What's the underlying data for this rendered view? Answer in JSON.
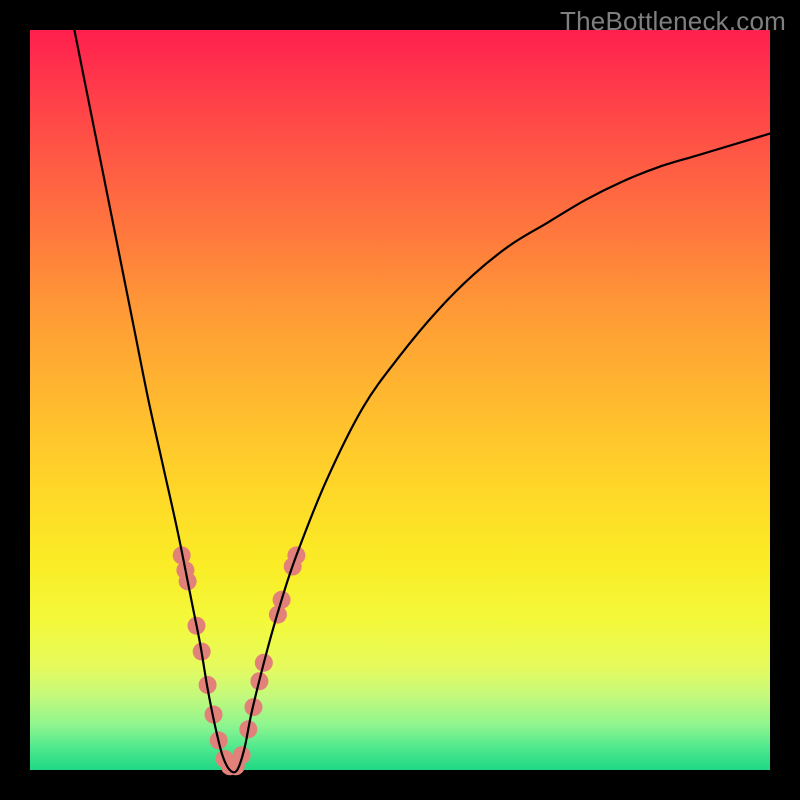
{
  "watermark": "TheBottleneck.com",
  "chart_data": {
    "type": "line",
    "title": "",
    "xlabel": "",
    "ylabel": "",
    "xlim": [
      0,
      100
    ],
    "ylim": [
      0,
      100
    ],
    "grid": false,
    "legend": false,
    "background_gradient": {
      "top": "#ff1f4d",
      "bottom": "#1fd885",
      "stops": [
        {
          "pos": 0.0,
          "color": "#ff1f4d"
        },
        {
          "pos": 0.5,
          "color": "#ffb92f"
        },
        {
          "pos": 0.8,
          "color": "#f3f93b"
        },
        {
          "pos": 1.0,
          "color": "#1fd885"
        }
      ]
    },
    "series": [
      {
        "name": "bottleneck-curve",
        "color": "#000000",
        "x": [
          6,
          8,
          10,
          12,
          14,
          16,
          18,
          20,
          22,
          23,
          24,
          25,
          26,
          27,
          28,
          29,
          30,
          32,
          34,
          36,
          40,
          45,
          50,
          55,
          60,
          65,
          70,
          75,
          80,
          85,
          90,
          95,
          100
        ],
        "y": [
          100,
          90,
          80,
          70,
          60,
          50,
          41,
          32,
          22,
          17,
          11,
          6,
          2,
          0,
          0,
          3,
          8,
          16,
          23,
          29,
          39,
          49,
          56,
          62,
          67,
          71,
          74,
          77,
          79.5,
          81.5,
          83,
          84.5,
          86
        ]
      }
    ],
    "markers": {
      "name": "highlight-dots",
      "color": "#e2807a",
      "radius_px": 9,
      "points": [
        {
          "x": 20.5,
          "y": 29
        },
        {
          "x": 21.0,
          "y": 27
        },
        {
          "x": 21.3,
          "y": 25.5
        },
        {
          "x": 22.5,
          "y": 19.5
        },
        {
          "x": 23.2,
          "y": 16
        },
        {
          "x": 24.0,
          "y": 11.5
        },
        {
          "x": 24.8,
          "y": 7.5
        },
        {
          "x": 25.5,
          "y": 4
        },
        {
          "x": 26.3,
          "y": 1.5
        },
        {
          "x": 27.0,
          "y": 0.5
        },
        {
          "x": 27.8,
          "y": 0.5
        },
        {
          "x": 28.6,
          "y": 2
        },
        {
          "x": 29.5,
          "y": 5.5
        },
        {
          "x": 30.2,
          "y": 8.5
        },
        {
          "x": 31.0,
          "y": 12
        },
        {
          "x": 31.6,
          "y": 14.5
        },
        {
          "x": 33.5,
          "y": 21
        },
        {
          "x": 34.0,
          "y": 23
        },
        {
          "x": 35.5,
          "y": 27.5
        },
        {
          "x": 36.0,
          "y": 29
        }
      ]
    }
  }
}
